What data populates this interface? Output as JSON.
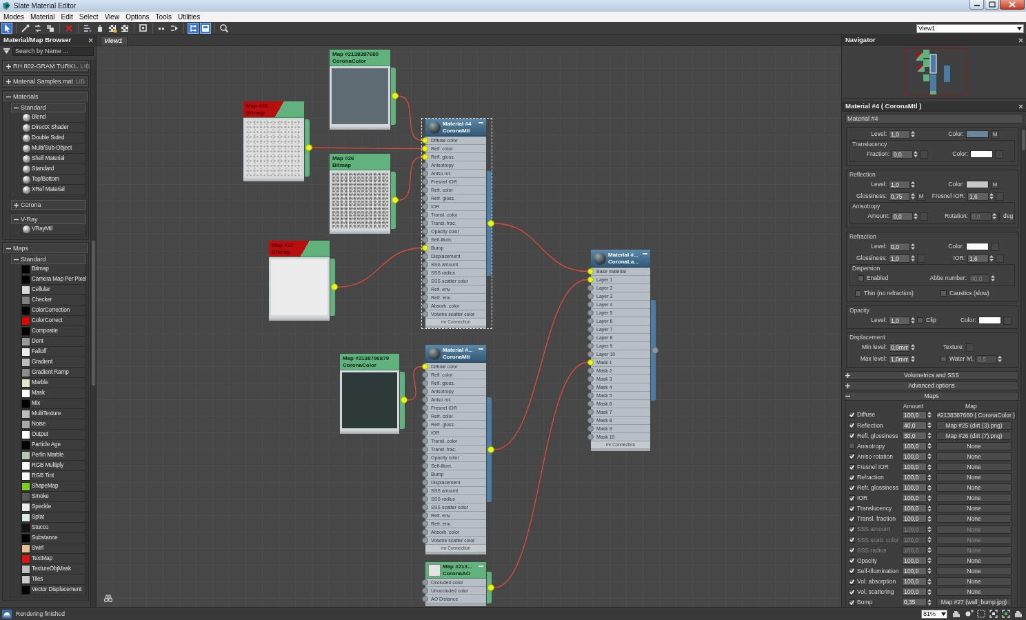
{
  "window": {
    "title": "Slate Material Editor"
  },
  "menu": [
    "Modes",
    "Material",
    "Edit",
    "Select",
    "View",
    "Options",
    "Tools",
    "Utilities"
  ],
  "toolbar": [
    {
      "selected": true
    },
    {
      "selected": false
    },
    {
      "selected": false
    },
    {
      "selected": false
    },
    {
      "selected": false
    },
    {
      "selected": false
    },
    {
      "selected": false
    },
    {
      "selected": false
    },
    {
      "selected": false
    },
    {
      "selected": false
    },
    {
      "selected": false
    },
    {
      "selected": false
    },
    {
      "selected": true
    },
    {
      "selected": true
    },
    {
      "selected": false
    }
  ],
  "view_select": {
    "value": "View1"
  },
  "browser": {
    "title": "Material/Map Browser",
    "search_placeholder": "Search by Name ...",
    "groups": [
      {
        "label": "RH 802-GRAM TURKI..",
        "tag": "LIB",
        "expanded": false
      },
      {
        "label": "Material Samples.mat",
        "tag": "LIB",
        "expanded": false
      },
      {
        "label": "Materials",
        "expanded": true,
        "children": [
          {
            "label": "Standard",
            "expanded": true,
            "items": [
              {
                "label": "Blend",
                "kind": "material"
              },
              {
                "label": "DirectX Shader",
                "kind": "material"
              },
              {
                "label": "Double Sided",
                "kind": "material"
              },
              {
                "label": "Multi/Sub-Object",
                "kind": "material"
              },
              {
                "label": "Shell Material",
                "kind": "material"
              },
              {
                "label": "Standard",
                "kind": "material"
              },
              {
                "label": "Top/Bottom",
                "kind": "material"
              },
              {
                "label": "XRef Material",
                "kind": "material"
              }
            ]
          },
          {
            "label": "Corona",
            "expanded": false
          },
          {
            "label": "V-Ray",
            "expanded": true,
            "items": [
              {
                "label": "VRayMtl",
                "kind": "material"
              }
            ]
          }
        ]
      },
      {
        "label": "Maps",
        "expanded": true,
        "children": [
          {
            "label": "Standard",
            "expanded": true,
            "items": [
              {
                "label": "Bitmap",
                "kind": "map",
                "color": "#000000"
              },
              {
                "label": "Camera Map Per Pixel",
                "kind": "map",
                "color": "#000000"
              },
              {
                "label": "Cellular",
                "kind": "map",
                "color": "#d8d8d8"
              },
              {
                "label": "Checker",
                "kind": "map",
                "color": "#808080"
              },
              {
                "label": "ColorCorrection",
                "kind": "map",
                "color": "#000000"
              },
              {
                "label": "ColorCorrect",
                "kind": "map",
                "color": "#e00000"
              },
              {
                "label": "Composite",
                "kind": "map",
                "color": "#000000"
              },
              {
                "label": "Dent",
                "kind": "map",
                "color": "#9a9a9a"
              },
              {
                "label": "Falloff",
                "kind": "map",
                "color": "#eeeeee"
              },
              {
                "label": "Gradient",
                "kind": "map",
                "color": "#bdbdbd"
              },
              {
                "label": "Gradient Ramp",
                "kind": "map",
                "color": "#8c8c8c"
              },
              {
                "label": "Marble",
                "kind": "map",
                "color": "#dfe8c4"
              },
              {
                "label": "Mask",
                "kind": "map",
                "color": "#ffffff"
              },
              {
                "label": "Mix",
                "kind": "map",
                "color": "#000000"
              },
              {
                "label": "MultiTexture",
                "kind": "map",
                "color": "#bcbcbc"
              },
              {
                "label": "Noise",
                "kind": "map",
                "color": "#a8a8a8"
              },
              {
                "label": "Output",
                "kind": "map",
                "color": "#ffffff"
              },
              {
                "label": "Particle Age",
                "kind": "map",
                "color": "#050505"
              },
              {
                "label": "Perlin Marble",
                "kind": "map",
                "color": "#b8c4b4"
              },
              {
                "label": "RGB Multiply",
                "kind": "map",
                "color": "#fafafa"
              },
              {
                "label": "RGB Tint",
                "kind": "map",
                "color": "#fbfbfb"
              },
              {
                "label": "ShapeMap",
                "kind": "map",
                "color": "#7ccf1e"
              },
              {
                "label": "Smoke",
                "kind": "map",
                "color": "#5a5a5a"
              },
              {
                "label": "Speckle",
                "kind": "map",
                "color": "#ececec"
              },
              {
                "label": "Splat",
                "kind": "map",
                "color": "#dbe8e2"
              },
              {
                "label": "Stucco",
                "kind": "map",
                "color": "#141414"
              },
              {
                "label": "Substance",
                "kind": "map",
                "color": "#020202"
              },
              {
                "label": "Swirl",
                "kind": "map",
                "color": "#e6c08c"
              },
              {
                "label": "TextMap",
                "kind": "map",
                "color": "#e01414"
              },
              {
                "label": "TextureObjMask",
                "kind": "map",
                "color": "#c0c0c0"
              },
              {
                "label": "Tiles",
                "kind": "map",
                "color": "#cacaca"
              },
              {
                "label": "Vector Displacement",
                "kind": "map",
                "color": "#030303"
              }
            ]
          }
        ]
      }
    ]
  },
  "tabs": [
    {
      "label": "View1",
      "selected": true
    }
  ],
  "nodes": [
    {
      "kind": "swatch",
      "title": "Map #2138387680",
      "subtitle": "CoronaColor",
      "warning": false,
      "selected": false,
      "color": "#5e6b72",
      "output_connected": true
    },
    {
      "kind": "bitmap",
      "title": "Map #25",
      "subtitle": "Bitmap",
      "warning": true,
      "selected": false,
      "color": "#dedede",
      "output_connected": true
    },
    {
      "kind": "bitmap",
      "title": "Map #26",
      "subtitle": "Bitmap",
      "warning": false,
      "selected": false,
      "color": "#c6c6c6",
      "output_connected": true
    },
    {
      "kind": "bitmap",
      "title": "Map #27",
      "subtitle": "Bitmap",
      "warning": true,
      "selected": false,
      "color": "#ececec",
      "output_connected": true
    },
    {
      "kind": "swatch",
      "title": "Map #2138796879",
      "subtitle": "CoronaColor",
      "warning": false,
      "selected": false,
      "color": "#2e393a",
      "output_connected": true
    },
    {
      "kind": "material",
      "title": "Material #4",
      "subtitle": "CoronaMtl",
      "selected": true,
      "output_connected": true,
      "footer": "mr Connection",
      "slots": [
        {
          "label": "Diffuse color",
          "connected": true
        },
        {
          "label": "Refl. color",
          "connected": true
        },
        {
          "label": "Refl. gloss.",
          "connected": true
        },
        {
          "label": "Anisotropy",
          "connected": false
        },
        {
          "label": "Aniso rot.",
          "connected": false
        },
        {
          "label": "Fresnel IOR",
          "connected": false
        },
        {
          "label": "Refr. color",
          "connected": false
        },
        {
          "label": "Refr. gloss.",
          "connected": false
        },
        {
          "label": "IOR",
          "connected": false
        },
        {
          "label": "Transl. color",
          "connected": false
        },
        {
          "label": "Transl. frac.",
          "connected": false
        },
        {
          "label": "Opacity color",
          "connected": false
        },
        {
          "label": "Self-illum.",
          "connected": false
        },
        {
          "label": "Bump",
          "connected": true
        },
        {
          "label": "Displacement",
          "connected": false
        },
        {
          "label": "SSS amount",
          "connected": false
        },
        {
          "label": "SSS radius",
          "connected": false
        },
        {
          "label": "SSS scatter color",
          "connected": false
        },
        {
          "label": "Refl. env.",
          "connected": false
        },
        {
          "label": "Refr. env.",
          "connected": false
        },
        {
          "label": "Absorb. color",
          "connected": false
        },
        {
          "label": "Volume scatter color",
          "connected": false
        }
      ]
    },
    {
      "kind": "material",
      "title": "Material #...",
      "subtitle": "CoronaMtl",
      "selected": false,
      "output_connected": true,
      "footer": "mr Connection",
      "slots": [
        {
          "label": "Diffuse color",
          "connected": true
        },
        {
          "label": "Refl. color",
          "connected": false
        },
        {
          "label": "Refl. gloss.",
          "connected": false
        },
        {
          "label": "Anisotropy",
          "connected": false
        },
        {
          "label": "Aniso rot.",
          "connected": false
        },
        {
          "label": "Fresnel IOR",
          "connected": false
        },
        {
          "label": "Refr. color",
          "connected": false
        },
        {
          "label": "Refr. gloss.",
          "connected": false
        },
        {
          "label": "IOR",
          "connected": false
        },
        {
          "label": "Transl. color",
          "connected": false
        },
        {
          "label": "Transl. frac.",
          "connected": false
        },
        {
          "label": "Opacity color",
          "connected": false
        },
        {
          "label": "Self-illum.",
          "connected": false
        },
        {
          "label": "Bump",
          "connected": false
        },
        {
          "label": "Displacement",
          "connected": false
        },
        {
          "label": "SSS amount",
          "connected": false
        },
        {
          "label": "SSS radius",
          "connected": false
        },
        {
          "label": "SSS scatter color",
          "connected": false
        },
        {
          "label": "Refl. env.",
          "connected": false
        },
        {
          "label": "Refr. env.",
          "connected": false
        },
        {
          "label": "Absorb. color",
          "connected": false
        },
        {
          "label": "Volume scatter color",
          "connected": false
        }
      ]
    },
    {
      "kind": "map_slots",
      "title": "Map #213...",
      "subtitle": "CoronaAO",
      "selected": false,
      "output_connected": true,
      "slots": [
        {
          "label": "Occluded color",
          "connected": false
        },
        {
          "label": "Unoccluded color",
          "connected": false
        },
        {
          "label": "AO Distance",
          "connected": false
        }
      ]
    },
    {
      "kind": "material",
      "title": "Material #...",
      "subtitle": "CoronaLa...",
      "selected": false,
      "output_connected": false,
      "footer": "mr Connection",
      "slots": [
        {
          "label": "Base material",
          "connected": true
        },
        {
          "label": "Layer 1",
          "connected": true
        },
        {
          "label": "Layer 2",
          "connected": false
        },
        {
          "label": "Layer 3",
          "connected": false
        },
        {
          "label": "Layer 4",
          "connected": false
        },
        {
          "label": "Layer 5",
          "connected": false
        },
        {
          "label": "Layer 6",
          "connected": false
        },
        {
          "label": "Layer 7",
          "connected": false
        },
        {
          "label": "Layer 8",
          "connected": false
        },
        {
          "label": "Layer 9",
          "connected": false
        },
        {
          "label": "Layer 10",
          "connected": false
        },
        {
          "label": "Mask 1",
          "connected": true
        },
        {
          "label": "Mask 2",
          "connected": false
        },
        {
          "label": "Mask 3",
          "connected": false
        },
        {
          "label": "Mask 4",
          "connected": false
        },
        {
          "label": "Mask 5",
          "connected": false
        },
        {
          "label": "Mask 6",
          "connected": false
        },
        {
          "label": "Mask 7",
          "connected": false
        },
        {
          "label": "Mask 8",
          "connected": false
        },
        {
          "label": "Mask 9",
          "connected": false
        },
        {
          "label": "Mask 10",
          "connected": false
        }
      ]
    }
  ],
  "navigator": {
    "title": "Navigator"
  },
  "material_panel": {
    "title": "Material #4 ( CoronaMtl )",
    "name_value": "Material #4",
    "groups": [
      {
        "items": [
          {
            "kind": "row",
            "left": [
              {
                "kind": "label",
                "text": "Level:"
              },
              {
                "kind": "spinner",
                "value": "1,0",
                "disabled": false
              }
            ],
            "right": [
              {
                "kind": "label",
                "text": "Color:"
              },
              {
                "kind": "swatch",
                "color": "#6a8797"
              },
              {
                "kind": "mapbutton",
                "text": "M"
              }
            ]
          },
          {
            "kind": "subgroup",
            "title": "Translucency",
            "rows": [
              {
                "left": [
                  {
                    "kind": "label",
                    "text": "Fraction:"
                  },
                  {
                    "kind": "spinner",
                    "value": "0,0",
                    "disabled": false
                  },
                  {
                    "kind": "mapbutton"
                  }
                ],
                "right": [
                  {
                    "kind": "label",
                    "text": "Color:"
                  },
                  {
                    "kind": "swatch",
                    "color": "#ffffff"
                  },
                  {
                    "kind": "mapbutton"
                  }
                ]
              }
            ]
          }
        ]
      },
      {
        "title": "Reflection",
        "items": [
          {
            "kind": "row",
            "left": [
              {
                "kind": "label",
                "text": "Level:"
              },
              {
                "kind": "spinner",
                "value": "1,0",
                "disabled": false
              }
            ],
            "right": [
              {
                "kind": "label",
                "text": "Color:"
              },
              {
                "kind": "swatch",
                "color": "#c8c8c8"
              },
              {
                "kind": "mapbutton",
                "text": "M"
              }
            ]
          },
          {
            "kind": "row",
            "left": [
              {
                "kind": "label",
                "text": "Glossiness:"
              },
              {
                "kind": "spinner",
                "value": "0,75",
                "disabled": false
              },
              {
                "kind": "mapbutton",
                "text": "M"
              }
            ],
            "right": [
              {
                "kind": "label",
                "text": "Fresnel IOR:"
              },
              {
                "kind": "spinner",
                "value": "1,6",
                "disabled": false
              },
              {
                "kind": "mapbutton"
              }
            ]
          },
          {
            "kind": "subgroup",
            "title": "Anisotropy",
            "rows": [
              {
                "left": [
                  {
                    "kind": "label",
                    "text": "Amount:"
                  },
                  {
                    "kind": "spinner",
                    "value": "0,0",
                    "disabled": false
                  },
                  {
                    "kind": "mapbutton"
                  }
                ],
                "right": [
                  {
                    "kind": "label",
                    "text": "Rotation:"
                  },
                  {
                    "kind": "spinner",
                    "value": "0,0",
                    "disabled": true
                  },
                  {
                    "kind": "mapbutton"
                  },
                  {
                    "kind": "unit",
                    "text": "deg"
                  }
                ]
              }
            ]
          }
        ]
      },
      {
        "title": "Refraction",
        "items": [
          {
            "kind": "row",
            "left": [
              {
                "kind": "label",
                "text": "Level:"
              },
              {
                "kind": "spinner",
                "value": "0,0",
                "disabled": false
              }
            ],
            "right": [
              {
                "kind": "label",
                "text": "Color:"
              },
              {
                "kind": "swatch",
                "color": "#ffffff"
              },
              {
                "kind": "mapbutton"
              }
            ]
          },
          {
            "kind": "row",
            "left": [
              {
                "kind": "label",
                "text": "Glossiness:"
              },
              {
                "kind": "spinner",
                "value": "1,0",
                "disabled": false
              },
              {
                "kind": "mapbutton"
              }
            ],
            "right": [
              {
                "kind": "label",
                "text": "IOR:"
              },
              {
                "kind": "spinner",
                "value": "1,6",
                "disabled": false
              },
              {
                "kind": "mapbutton"
              }
            ]
          },
          {
            "kind": "subgroup",
            "title": "Dispersion",
            "rows": [
              {
                "left": [
                  {
                    "kind": "checkbox",
                    "label": "Enabled",
                    "checked": false
                  }
                ],
                "right": [
                  {
                    "kind": "label",
                    "text": "Abbe number:"
                  },
                  {
                    "kind": "spinner",
                    "value": "40,0",
                    "disabled": true
                  }
                ]
              }
            ]
          },
          {
            "kind": "row",
            "left": [
              {
                "kind": "checkbox",
                "label": "Thin (no refraction)",
                "checked": false
              }
            ],
            "right": [
              {
                "kind": "checkbox",
                "label": "Caustics (slow)",
                "checked": false
              }
            ]
          }
        ]
      },
      {
        "title": "Opacity",
        "items": [
          {
            "kind": "row",
            "left": [
              {
                "kind": "label",
                "text": "Level:"
              },
              {
                "kind": "spinner",
                "value": "1,0",
                "disabled": false
              },
              {
                "kind": "checkbox",
                "label": "Clip",
                "checked": false
              }
            ],
            "right": [
              {
                "kind": "label",
                "text": "Color:"
              },
              {
                "kind": "swatch",
                "color": "#ffffff"
              },
              {
                "kind": "mapbutton"
              }
            ]
          }
        ]
      },
      {
        "title": "Displacement",
        "items": [
          {
            "kind": "row",
            "left": [
              {
                "kind": "label",
                "text": "Min level:"
              },
              {
                "kind": "spinner",
                "value": "0,0mm",
                "disabled": false
              }
            ],
            "right": [
              {
                "kind": "label",
                "text": "Texture:"
              },
              {
                "kind": "mapbutton"
              }
            ]
          },
          {
            "kind": "row",
            "left": [
              {
                "kind": "label",
                "text": "Max level:"
              },
              {
                "kind": "spinner",
                "value": "1,0mm",
                "disabled": false
              }
            ],
            "right": [
              {
                "kind": "checkbox",
                "label": "Water lvl.",
                "checked": false
              },
              {
                "kind": "spinner",
                "value": "0,5",
                "disabled": true
              }
            ]
          }
        ]
      }
    ],
    "rollouts": [
      {
        "title": "Volumetrics and SSS",
        "expanded": false
      },
      {
        "title": "Advanced options",
        "expanded": false
      },
      {
        "title": "Maps",
        "expanded": true,
        "columns": [
          "Amount",
          "Map"
        ],
        "rows": [
          {
            "checked": true,
            "label": "Diffuse",
            "amount": "100,0",
            "map": "#2138387680 ( CoronaColor )",
            "disabled": false
          },
          {
            "checked": true,
            "label": "Reflection",
            "amount": "40,0",
            "map": "Map #25 (dirt (3).png)",
            "disabled": false
          },
          {
            "checked": true,
            "label": "Refl. glossiness",
            "amount": "30,0",
            "map": "Map #26 (dirt (7).png)",
            "disabled": false
          },
          {
            "checked": false,
            "label": "Anisotropy",
            "amount": "100,0",
            "map": "None",
            "disabled": false
          },
          {
            "checked": true,
            "label": "Aniso rotation",
            "amount": "100,0",
            "map": "None",
            "disabled": false
          },
          {
            "checked": true,
            "label": "Fresnel IOR",
            "amount": "100,0",
            "map": "None",
            "disabled": false
          },
          {
            "checked": true,
            "label": "Refraction",
            "amount": "100,0",
            "map": "None",
            "disabled": false
          },
          {
            "checked": true,
            "label": "Refr. glossiness",
            "amount": "100,0",
            "map": "None",
            "disabled": false
          },
          {
            "checked": true,
            "label": "IOR",
            "amount": "100,0",
            "map": "None",
            "disabled": false
          },
          {
            "checked": true,
            "label": "Translucency",
            "amount": "100,0",
            "map": "None",
            "disabled": false
          },
          {
            "checked": true,
            "label": "Transl. fraction",
            "amount": "100,0",
            "map": "None",
            "disabled": false
          },
          {
            "checked": true,
            "label": "SSS amount",
            "amount": "100,0",
            "map": "None",
            "disabled": true
          },
          {
            "checked": true,
            "label": "SSS scatt. color",
            "amount": "100,0",
            "map": "None",
            "disabled": true
          },
          {
            "checked": true,
            "label": "SSS radius",
            "amount": "100,0",
            "map": "None",
            "disabled": true
          },
          {
            "checked": true,
            "label": "Opacity",
            "amount": "100,0",
            "map": "None",
            "disabled": false
          },
          {
            "checked": true,
            "label": "Self-Illumination",
            "amount": "100,0",
            "map": "None",
            "disabled": false
          },
          {
            "checked": true,
            "label": "Vol. absorption",
            "amount": "100,0",
            "map": "None",
            "disabled": false
          },
          {
            "checked": true,
            "label": "Vol. scattering",
            "amount": "100,0",
            "map": "None",
            "disabled": false
          },
          {
            "checked": true,
            "label": "Bump",
            "amount": "0,35",
            "map": "Map #27 (wall_bump.jpg)",
            "disabled": false
          }
        ]
      }
    ]
  },
  "status_bar": {
    "message": "Rendering finished",
    "zoom": "81%"
  }
}
